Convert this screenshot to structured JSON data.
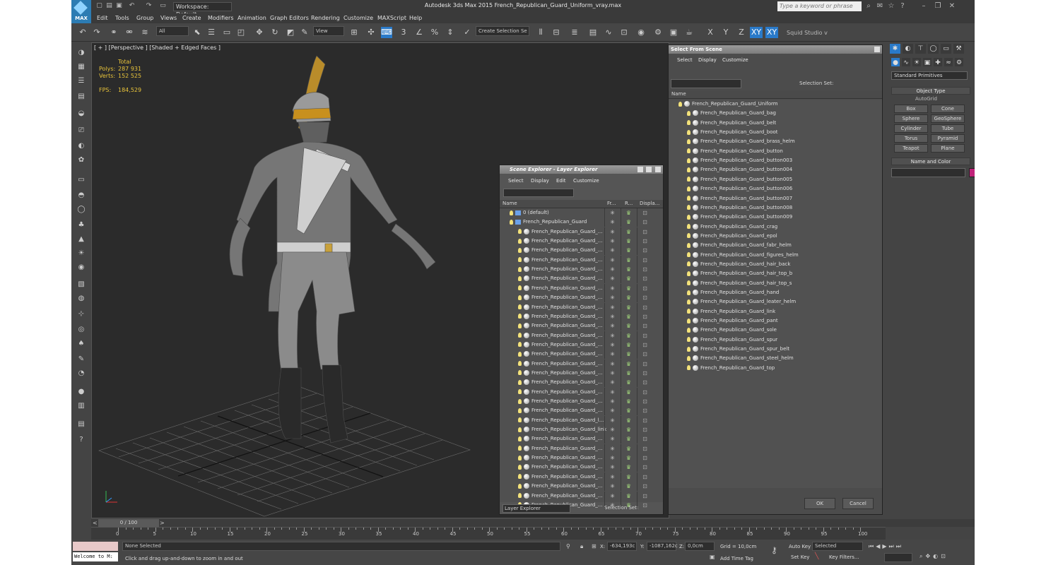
{
  "app": {
    "title": "Autodesk 3ds Max  2015     French_Republican_Guard_Uniform_vray.max",
    "logo": "MAX",
    "workspace": "Workspace: Default",
    "search_placeholder": "Type a keyword or phrase"
  },
  "menu": [
    "Edit",
    "Tools",
    "Group",
    "Views",
    "Create",
    "Modifiers",
    "Animation",
    "Graph Editors",
    "Rendering",
    "Customize",
    "MAXScript",
    "Help"
  ],
  "toolbar": {
    "filter": "All",
    "refcoord": "View",
    "selset": "Create Selection Se",
    "axes": [
      "X",
      "Y",
      "Z",
      "XY",
      "XY"
    ],
    "studio": "Squid Studio v"
  },
  "viewport": {
    "label": "[ + ] [Perspective ] [Shaded + Edged Faces ]",
    "stats_header": "Total",
    "polys_label": "Polys:",
    "polys": "287 931",
    "verts_label": "Verts:",
    "verts": "152 525",
    "fps_label": "FPS:",
    "fps": "184,529"
  },
  "panel": {
    "dropdown": "Standard Primitives",
    "object_type": "Object Type",
    "autogrid": "AutoGrid",
    "buttons": [
      "Box",
      "Cone",
      "Sphere",
      "GeoSphere",
      "Cylinder",
      "Tube",
      "Torus",
      "Pyramid",
      "Teapot",
      "Plane"
    ],
    "name_color": "Name and Color",
    "accent_color": "#c0237a"
  },
  "scene_explorer": {
    "title": "Scene Explorer - Layer Explorer",
    "menu": [
      "Select",
      "Display",
      "Edit",
      "Customize"
    ],
    "col_name": "Name",
    "col_fr": "Fr...",
    "col_r": "R...",
    "col_disp": "Displa...",
    "layer_default": "0 (default)",
    "layer_main": "French_Republican_Guard",
    "rows": [
      "French_Republican_Guard_...",
      "French_Republican_Guard_...",
      "French_Republican_Guard_...",
      "French_Republican_Guard_...",
      "French_Republican_Guard_...",
      "French_Republican_Guard_...",
      "French_Republican_Guard_...",
      "French_Republican_Guard_...",
      "French_Republican_Guard_...",
      "French_Republican_Guard_...",
      "French_Republican_Guard_...",
      "French_Republican_Guard_...",
      "French_Republican_Guard_...",
      "French_Republican_Guard_...",
      "French_Republican_Guard_...",
      "French_Republican_Guard_...",
      "French_Republican_Guard_...",
      "French_Republican_Guard_...",
      "French_Republican_Guard_...",
      "French_Republican_Guard_...",
      "French_Republican_Guard_l...",
      "French_Republican_Guard_link",
      "French_Republican_Guard_...",
      "French_Republican_Guard_...",
      "French_Republican_Guard_...",
      "French_Republican_Guard_...",
      "French_Republican_Guard_...",
      "French_Republican_Guard_...",
      "French_Republican_Guard_...",
      "French_Republican_Guard_..."
    ],
    "footer_left": "Layer Explorer",
    "footer_right": "Selection Set:"
  },
  "select_scene": {
    "title": "Select From Scene",
    "menu": [
      "Select",
      "Display",
      "Customize"
    ],
    "selset": "Selection Set:",
    "col_name": "Name",
    "root": "French_Republican_Guard_Uniform",
    "items": [
      "French_Republican_Guard_bag",
      "French_Republican_Guard_belt",
      "French_Republican_Guard_boot",
      "French_Republican_Guard_brass_helm",
      "French_Republican_Guard_button",
      "French_Republican_Guard_button003",
      "French_Republican_Guard_button004",
      "French_Republican_Guard_button005",
      "French_Republican_Guard_button006",
      "French_Republican_Guard_button007",
      "French_Republican_Guard_button008",
      "French_Republican_Guard_button009",
      "French_Republican_Guard_crag",
      "French_Republican_Guard_epol",
      "French_Republican_Guard_fabr_helm",
      "French_Republican_Guard_figures_helm",
      "French_Republican_Guard_hair_back",
      "French_Republican_Guard_hair_top_b",
      "French_Republican_Guard_hair_top_s",
      "French_Republican_Guard_hand",
      "French_Republican_Guard_leater_helm",
      "French_Republican_Guard_link",
      "French_Republican_Guard_pant",
      "French_Republican_Guard_sole",
      "French_Republican_Guard_spur",
      "French_Republican_Guard_spur_belt",
      "French_Republican_Guard_steel_helm",
      "French_Republican_Guard_top"
    ],
    "ok": "OK",
    "cancel": "Cancel"
  },
  "timeline": {
    "frame": "0 / 100",
    "ticks": [
      "0",
      "5",
      "10",
      "15",
      "20",
      "25",
      "30",
      "35",
      "40",
      "45",
      "50",
      "55",
      "60",
      "65",
      "70",
      "75",
      "80",
      "85",
      "90",
      "95",
      "100"
    ]
  },
  "status": {
    "selected": "None Selected",
    "prompt": "Click and drag up-and-down to zoom in and out",
    "welcome": "Welcome to M:",
    "x_label": "X:",
    "x": "-634,193c",
    "y_label": "Y:",
    "y": "-1087,162c",
    "z_label": "Z:",
    "z": "0,0cm",
    "grid": "Grid = 10,0cm",
    "add_time_tag": "Add Time Tag",
    "auto_key": "Auto Key",
    "set_key": "Set Key",
    "key_mode": "Selected",
    "key_filters": "Key Filters..."
  }
}
